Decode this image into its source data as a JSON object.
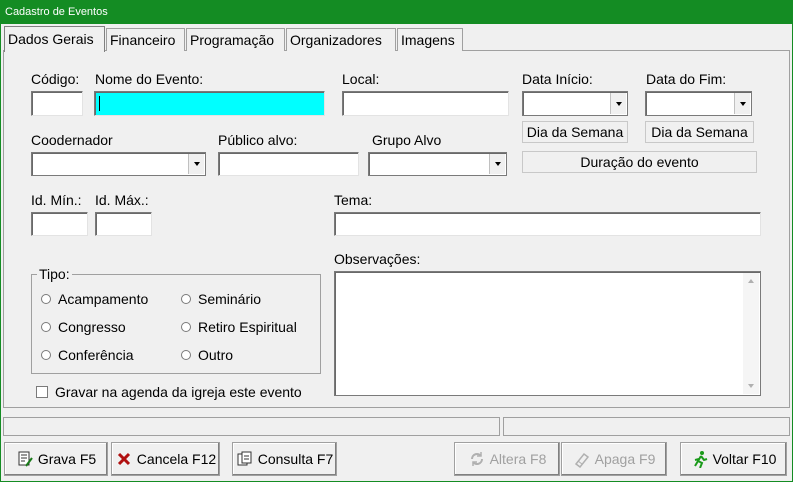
{
  "window": {
    "title": "Cadastro de Eventos"
  },
  "tabs": [
    {
      "label": "Dados Gerais",
      "active": true
    },
    {
      "label": "Financeiro"
    },
    {
      "label": "Programação"
    },
    {
      "label": "Organizadores"
    },
    {
      "label": "Imagens"
    }
  ],
  "form": {
    "codigo_label": "Código:",
    "codigo_value": "",
    "nome_label": "Nome do Evento:",
    "nome_value": "",
    "local_label": "Local:",
    "local_value": "",
    "data_inicio_label": "Data Início:",
    "data_inicio_value": "",
    "data_fim_label": "Data do Fim:",
    "data_fim_value": "",
    "dia_semana_inicio": "Dia da Semana",
    "dia_semana_fim": "Dia da Semana",
    "duracao": "Duração do evento",
    "coordenador_label": "Coodernador",
    "coordenador_value": "",
    "publico_label": "Público alvo:",
    "publico_value": "",
    "grupo_label": "Grupo Alvo",
    "grupo_value": "",
    "id_min_label": "Id. Mín.:",
    "id_min_value": "",
    "id_max_label": "Id. Máx.:",
    "id_max_value": "",
    "tema_label": "Tema:",
    "tema_value": "",
    "observacoes_label": "Observações:",
    "observacoes_value": "",
    "tipo_label": "Tipo:",
    "tipo_options": [
      "Acampamento",
      "Seminário",
      "Congresso",
      "Retiro Espiritual",
      "Conferência",
      "Outro"
    ],
    "gravar_agenda_label": "Gravar na agenda da igreja este evento"
  },
  "toolbar": {
    "grava": "Grava F5",
    "cancela": "Cancela F12",
    "consulta": "Consulta F7",
    "altera": "Altera F8",
    "apaga": "Apaga F9",
    "voltar": "Voltar F10"
  },
  "colors": {
    "titlebar": "#148c23",
    "nome_field": "#00ffff"
  }
}
